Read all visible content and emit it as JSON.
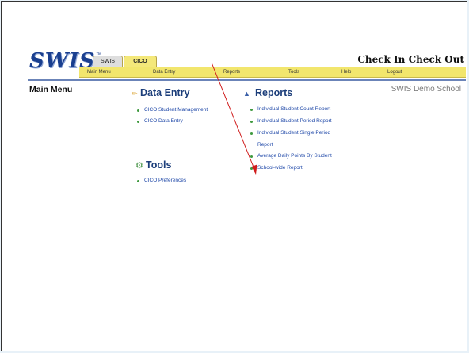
{
  "app": {
    "logo": "SWIS",
    "trademark": "™",
    "title": "Check In Check Out",
    "tabs": [
      {
        "label": "SWIS"
      },
      {
        "label": "CICO"
      }
    ]
  },
  "navbar": {
    "items": [
      "Main Menu",
      "Data Entry",
      "Reports",
      "Tools",
      "Help",
      "Logout"
    ]
  },
  "main": {
    "title": "Main Menu",
    "school": "SWIS Demo School"
  },
  "sections": {
    "data_entry": {
      "title": "Data Entry",
      "links": [
        "CICO Student Management",
        "CICO Data Entry"
      ]
    },
    "tools": {
      "title": "Tools",
      "links": [
        "CICO Preferences"
      ]
    },
    "reports": {
      "title": "Reports",
      "links": [
        "Individual Student Count Report",
        "Individual Student Period Report",
        "Individual Student Single Period",
        "Report",
        "Average Daily Points By Student",
        "School-wide Report"
      ]
    }
  },
  "colors": {
    "accent_yellow": "#f2e66d",
    "link_blue": "#1f48a8",
    "arrow_red": "#d01c1c"
  }
}
